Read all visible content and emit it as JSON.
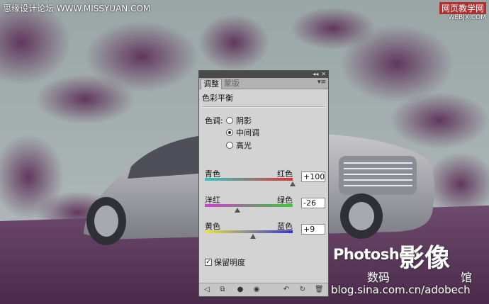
{
  "watermark": {
    "top_left": "思缘设计论坛 WWW.MISSYUAN.COM",
    "top_right_line1": "网页教学网",
    "top_right_line2": "WEBJX.COM"
  },
  "logo": {
    "photoshop": "Photoshop",
    "big": "影像",
    "small1": "数码",
    "small2": "馆",
    "url": "blog.sina.com.cn/adobech"
  },
  "panel": {
    "tabs": [
      {
        "label": "调整",
        "active": true
      },
      {
        "label": "蒙版",
        "active": false
      }
    ],
    "title": "色彩平衡",
    "tone": {
      "label": "色调:",
      "options": [
        {
          "label": "阴影",
          "selected": false
        },
        {
          "label": "中间调",
          "selected": true
        },
        {
          "label": "高光",
          "selected": false
        }
      ]
    },
    "sliders": [
      {
        "left": "青色",
        "right": "红色",
        "value": "+100",
        "num": 100
      },
      {
        "left": "洋红",
        "right": "绿色",
        "value": "-26",
        "num": -26
      },
      {
        "left": "黄色",
        "right": "蓝色",
        "value": "+9",
        "num": 9
      }
    ],
    "preserve_luminosity": {
      "label": "保留明度",
      "checked": true
    }
  }
}
